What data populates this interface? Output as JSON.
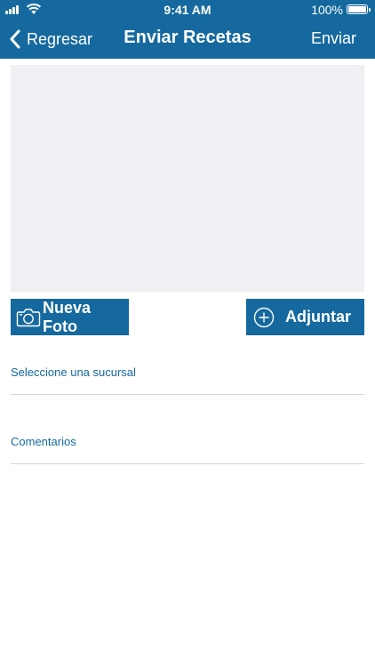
{
  "status_bar": {
    "time": "9:41 AM",
    "battery_percent": "100%",
    "battery_level": 1.0,
    "signal_icon": "cellular-signal-icon",
    "wifi_icon": "wifi-icon"
  },
  "nav": {
    "back_label": "Regresar",
    "title": "Enviar Recetas",
    "send_label": "Enviar"
  },
  "buttons": {
    "new_photo_label": "Nueva Foto",
    "new_photo_icon": "camera-icon",
    "attach_label": "Adjuntar",
    "attach_icon": "plus-circle-icon"
  },
  "form": {
    "branch_placeholder": "Seleccione una sucursal",
    "comments_placeholder": "Comentarios"
  },
  "colors": {
    "primary": "#15699e",
    "photo_placeholder_bg": "#efeff4",
    "divider": "#d6d6d6"
  }
}
